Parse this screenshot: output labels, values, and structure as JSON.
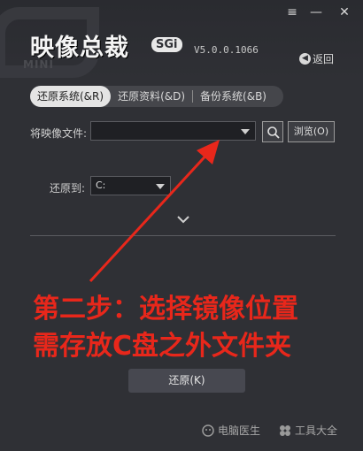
{
  "app": {
    "title": "映像总裁",
    "badge": "SGi",
    "watermark": "MINI",
    "version": "V5.0.0.1066"
  },
  "window_controls": {
    "menu_icon": "≡",
    "minimize_icon": "—",
    "close_icon": "✕"
  },
  "back_label": "返回",
  "tabs": [
    {
      "label": "还原系统(&R)",
      "active": true
    },
    {
      "label": "还原资料(&D)",
      "active": false
    },
    {
      "label": "备份系统(&B)",
      "active": false
    }
  ],
  "image_file": {
    "label": "将映像文件:",
    "value": "",
    "browse_label": "浏览(O)"
  },
  "restore_to": {
    "label": "还原到:",
    "value": "C:"
  },
  "annotation": {
    "line1": "第二步：选择镜像位置",
    "line2": "需存放C盘之外文件夹",
    "color": "#e8271b"
  },
  "restore_button": "还原(K)",
  "footer": {
    "doctor_label": "电脑医生",
    "tools_label": "工具大全"
  }
}
